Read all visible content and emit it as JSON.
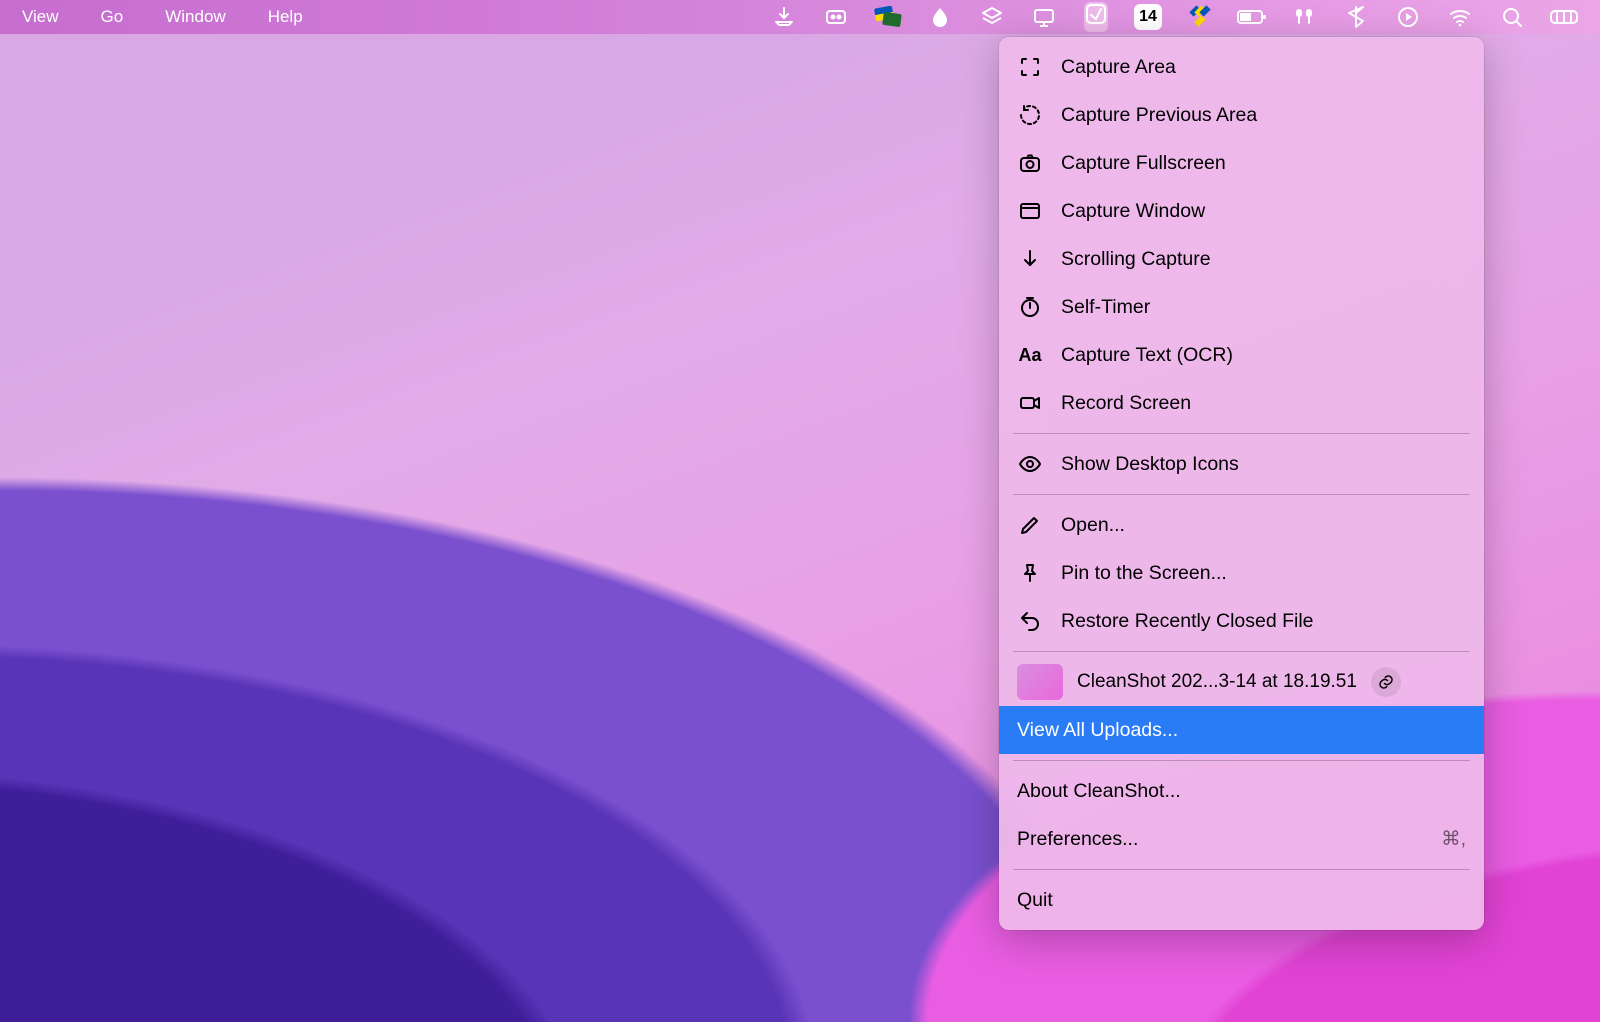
{
  "menubar": {
    "left": [
      "View",
      "Go",
      "Window",
      "Help"
    ],
    "calendar_badge": "14"
  },
  "dropdown": {
    "items": [
      {
        "icon": "capture-area-icon",
        "label": "Capture Area"
      },
      {
        "icon": "capture-previous-icon",
        "label": "Capture Previous Area"
      },
      {
        "icon": "camera-icon",
        "label": "Capture Fullscreen"
      },
      {
        "icon": "window-icon",
        "label": "Capture Window"
      },
      {
        "icon": "arrow-down-icon",
        "label": "Scrolling Capture"
      },
      {
        "icon": "timer-icon",
        "label": "Self-Timer"
      },
      {
        "icon": "text-aa-icon",
        "label": "Capture Text (OCR)"
      },
      {
        "icon": "video-icon",
        "label": "Record Screen"
      }
    ],
    "show_desktop": {
      "icon": "eye-icon",
      "label": "Show Desktop Icons"
    },
    "open": {
      "icon": "pencil-icon",
      "label": "Open..."
    },
    "pin": {
      "icon": "pin-icon",
      "label": "Pin to the Screen..."
    },
    "restore": {
      "icon": "undo-icon",
      "label": "Restore Recently Closed File"
    },
    "recent": {
      "label": "CleanShot 202...3-14 at 18.19.51"
    },
    "view_all": {
      "label": "View All Uploads..."
    },
    "about": {
      "label": "About CleanShot..."
    },
    "prefs": {
      "label": "Preferences...",
      "shortcut": "⌘,"
    },
    "quit": {
      "label": "Quit"
    }
  }
}
